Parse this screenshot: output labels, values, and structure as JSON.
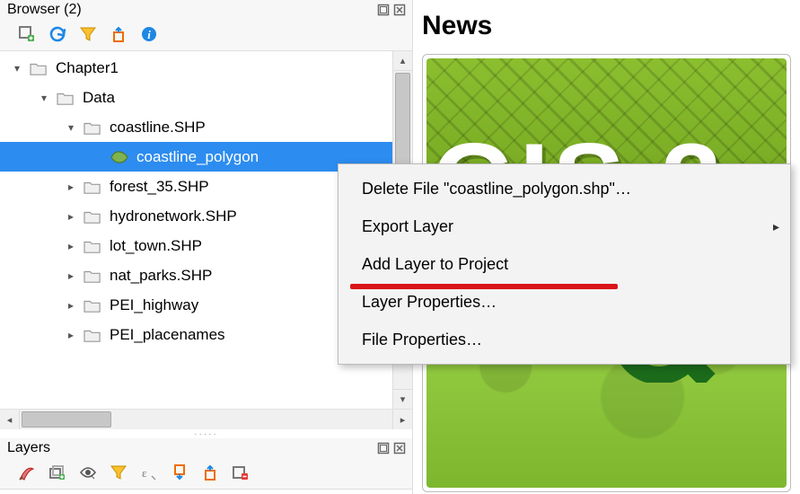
{
  "browserPanel": {
    "title": "Browser (2)"
  },
  "tree": {
    "items": [
      {
        "indent": 0,
        "expander": "down",
        "icon": "folder",
        "label": "Chapter1"
      },
      {
        "indent": 1,
        "expander": "down",
        "icon": "folder",
        "label": "Data"
      },
      {
        "indent": 2,
        "expander": "down",
        "icon": "folder",
        "label": "coastline.SHP"
      },
      {
        "indent": 3,
        "expander": "none",
        "icon": "polygon",
        "label": "coastline_polygon",
        "selected": true
      },
      {
        "indent": 2,
        "expander": "right",
        "icon": "folder",
        "label": "forest_35.SHP"
      },
      {
        "indent": 2,
        "expander": "right",
        "icon": "folder",
        "label": "hydronetwork.SHP"
      },
      {
        "indent": 2,
        "expander": "right",
        "icon": "folder",
        "label": "lot_town.SHP"
      },
      {
        "indent": 2,
        "expander": "right",
        "icon": "folder",
        "label": "nat_parks.SHP"
      },
      {
        "indent": 2,
        "expander": "right",
        "icon": "folder",
        "label": "PEI_highway"
      },
      {
        "indent": 2,
        "expander": "right",
        "icon": "folder",
        "label": "PEI_placenames"
      }
    ]
  },
  "layersPanel": {
    "title": "Layers"
  },
  "contextMenu": {
    "items": [
      {
        "label": "Delete File \"coastline_polygon.shp\"…"
      },
      {
        "label": "Export Layer",
        "submenu": true
      },
      {
        "label": "Add Layer to Project",
        "highlight": true
      },
      {
        "label": "Layer Properties…"
      },
      {
        "label": "File Properties…"
      }
    ]
  },
  "news": {
    "title": "News",
    "card1_text": "GIS 3"
  }
}
